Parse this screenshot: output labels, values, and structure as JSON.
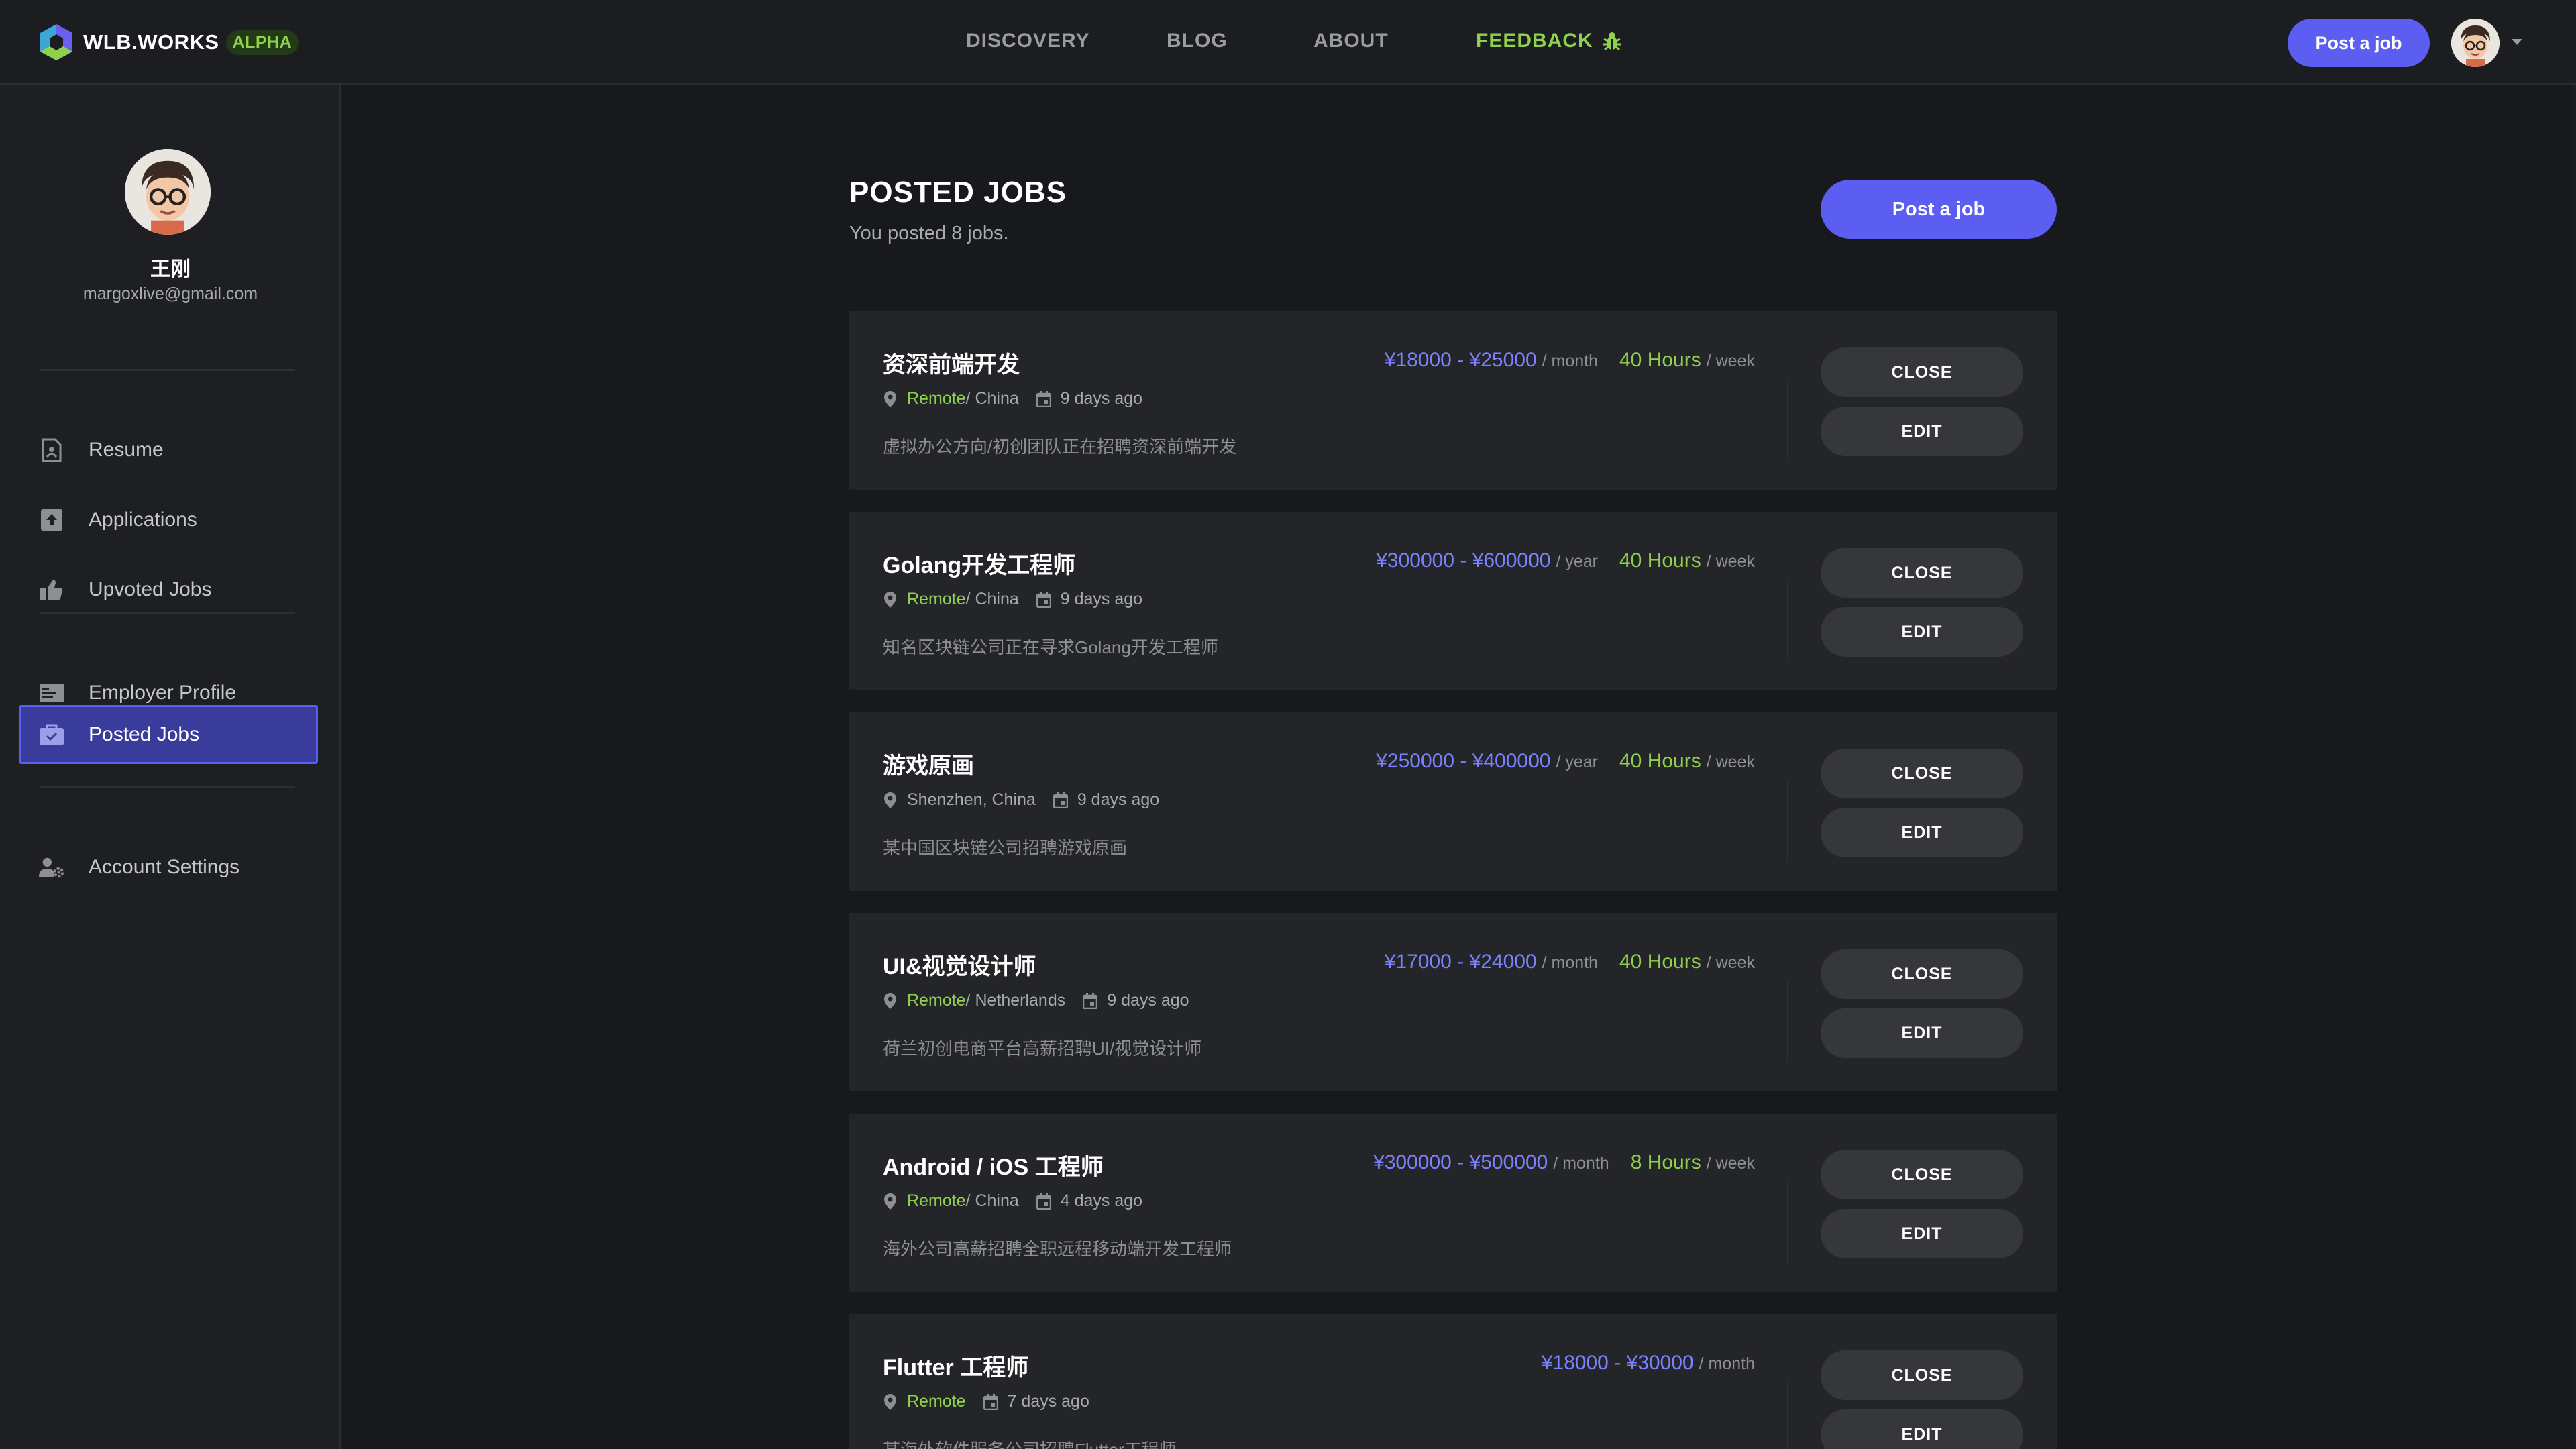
{
  "brand": {
    "name": "WLB.WORKS",
    "badge": "ALPHA",
    "colors": {
      "accent": "#5b5ef0",
      "green": "#8fd14f"
    }
  },
  "nav": {
    "links": [
      "DISCOVERY",
      "BLOG",
      "ABOUT",
      "FEEDBACK"
    ],
    "post_label": "Post a job"
  },
  "sidebar": {
    "name": "王刚",
    "email": "margoxlive@gmail.com",
    "items": [
      {
        "label": "Resume",
        "icon": "resume-icon"
      },
      {
        "label": "Applications",
        "icon": "upload-icon"
      },
      {
        "label": "Upvoted Jobs",
        "icon": "thumbs-up-icon"
      },
      {
        "label": "Employer Profile",
        "icon": "id-card-icon"
      },
      {
        "label": "Posted Jobs",
        "icon": "briefcase-icon",
        "active": true
      },
      {
        "label": "Account Settings",
        "icon": "user-gear-icon"
      }
    ]
  },
  "main": {
    "title": "POSTED JOBS",
    "subtitle": "You posted 8 jobs.",
    "post_label": "Post a job",
    "close_label": "CLOSE",
    "edit_label": "EDIT",
    "jobs": [
      {
        "title": "资深前端开发",
        "remote": "Remote",
        "location": " / China",
        "posted": "9 days ago",
        "description": "虚拟办公方向/初创团队正在招聘资深前端开发",
        "salary": "¥18000 - ¥25000",
        "unit": "/ month",
        "hours": "40 Hours",
        "hours_unit": "/ week"
      },
      {
        "title": "Golang开发工程师",
        "remote": "Remote",
        "location": " / China",
        "posted": "9 days ago",
        "description": "知名区块链公司正在寻求Golang开发工程师",
        "salary": "¥300000 - ¥600000",
        "unit": "/ year",
        "hours": "40 Hours",
        "hours_unit": "/ week"
      },
      {
        "title": "游戏原画",
        "remote": "",
        "location": "Shenzhen, China",
        "posted": "9 days ago",
        "description": "某中国区块链公司招聘游戏原画",
        "salary": "¥250000 - ¥400000",
        "unit": "/ year",
        "hours": "40 Hours",
        "hours_unit": "/ week"
      },
      {
        "title": "UI&视觉设计师",
        "remote": "Remote",
        "location": " / Netherlands",
        "posted": "9 days ago",
        "description": "荷兰初创电商平台高薪招聘UI/视觉设计师",
        "salary": "¥17000 - ¥24000",
        "unit": "/ month",
        "hours": "40 Hours",
        "hours_unit": "/ week"
      },
      {
        "title": "Android / iOS 工程师",
        "remote": "Remote",
        "location": " / China",
        "posted": "4 days ago",
        "description": "海外公司高薪招聘全职远程移动端开发工程师",
        "salary": "¥300000 - ¥500000",
        "unit": "/ month",
        "hours": "8 Hours",
        "hours_unit": "/ week"
      },
      {
        "title": "Flutter 工程师",
        "remote": "Remote",
        "location": "",
        "posted": "7 days ago",
        "description": "某海外软件服务公司招聘Flutter工程师",
        "salary": "¥18000 - ¥30000",
        "unit": "/ month",
        "hours": "",
        "hours_unit": ""
      }
    ]
  }
}
